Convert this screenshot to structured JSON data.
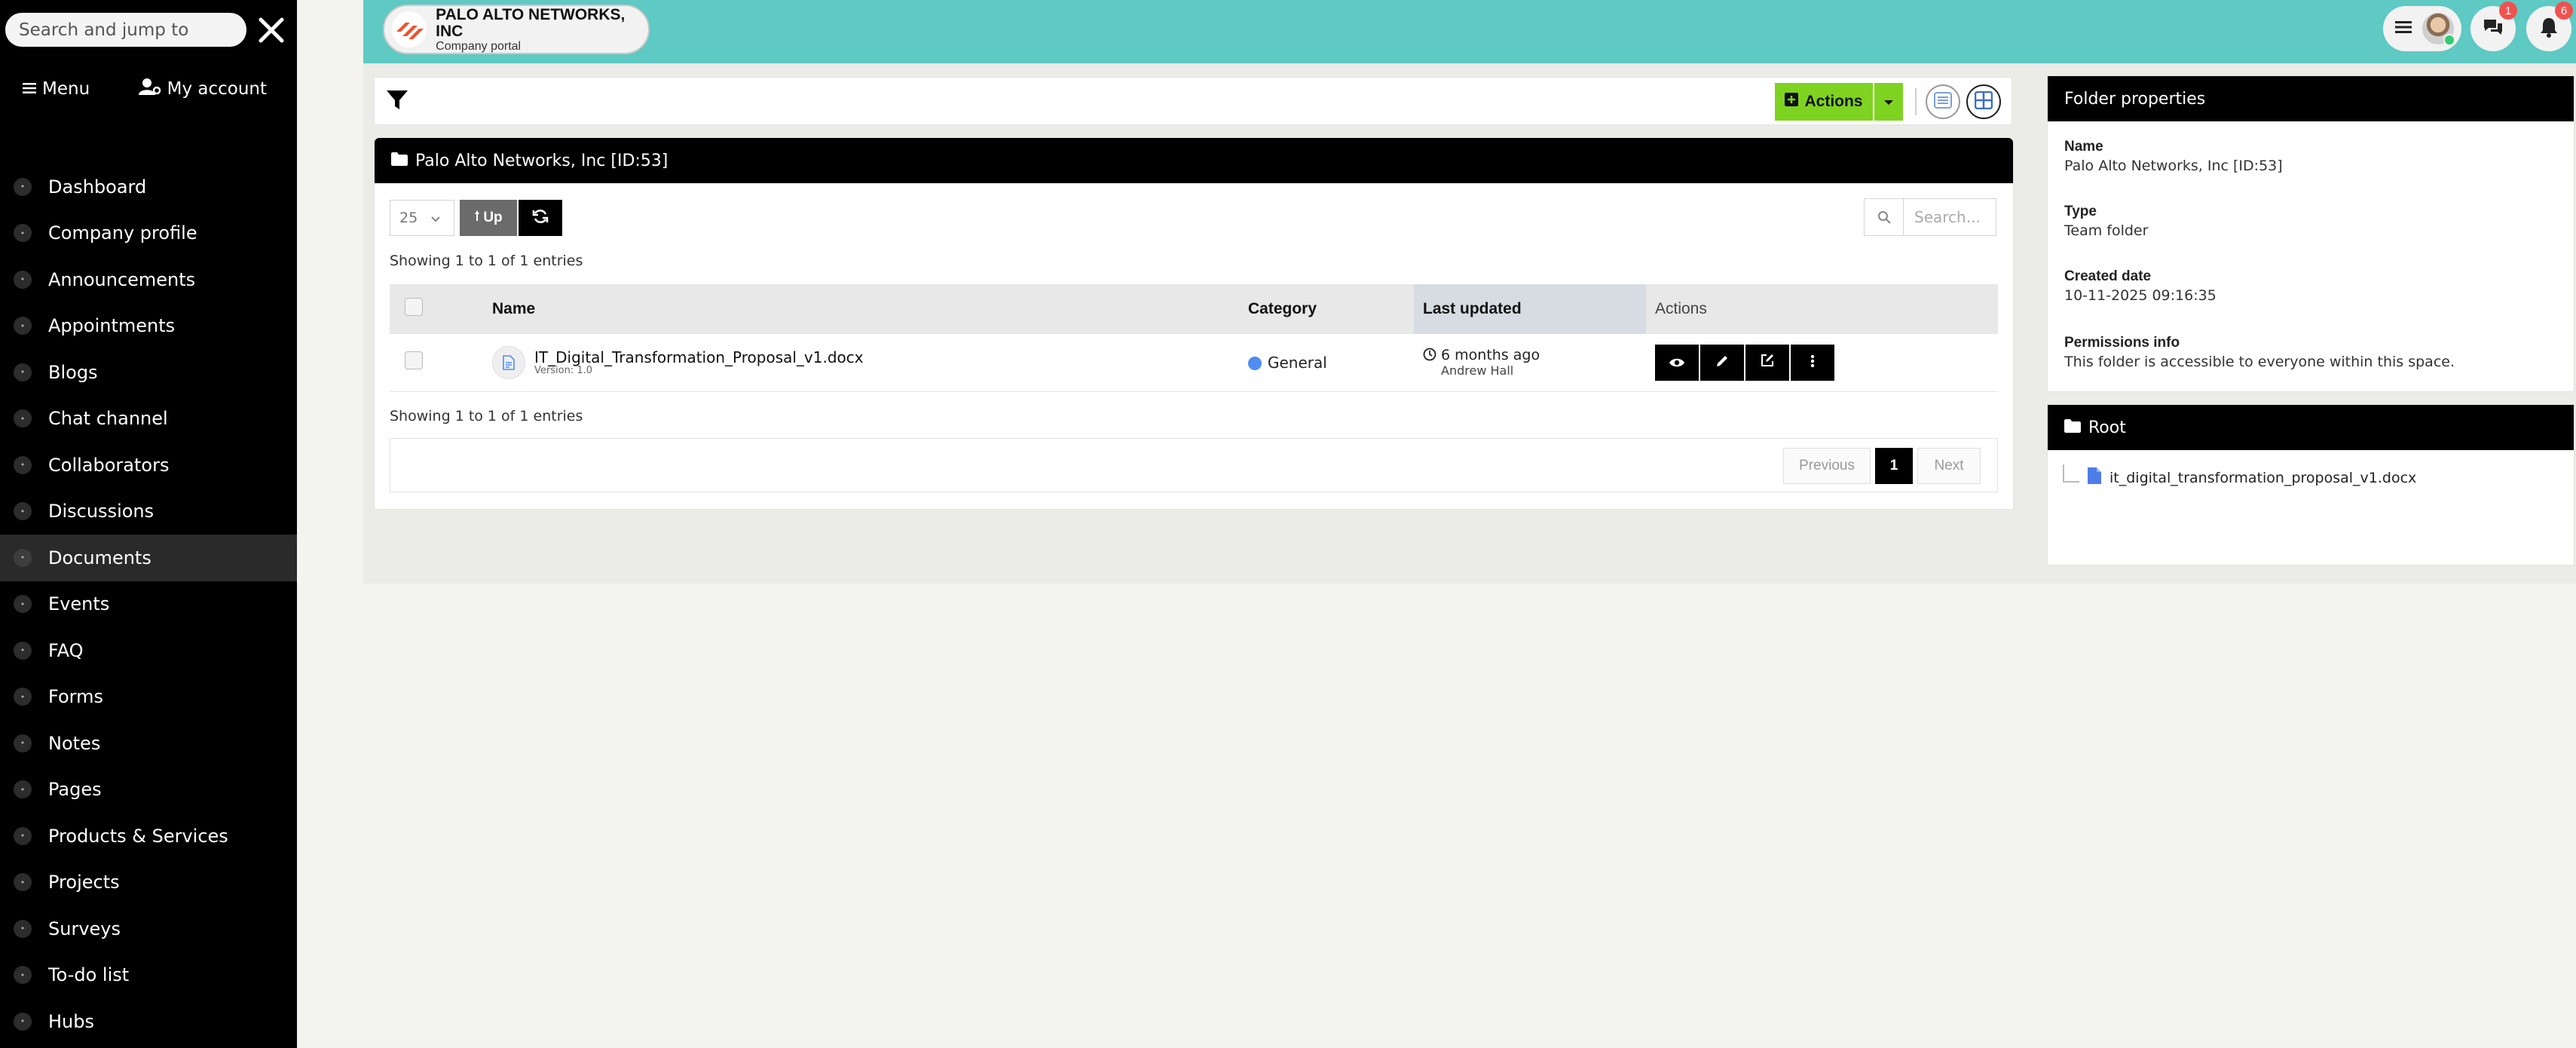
{
  "sidebar": {
    "search_placeholder": "Search and jump to",
    "menu_label": "Menu",
    "account_label": "My account",
    "items": [
      {
        "label": "Dashboard",
        "icon": "home-icon"
      },
      {
        "label": "Company profile",
        "icon": "building-icon"
      },
      {
        "label": "Announcements",
        "icon": "megaphone-icon"
      },
      {
        "label": "Appointments",
        "icon": "calendar-icon"
      },
      {
        "label": "Blogs",
        "icon": "pen-icon"
      },
      {
        "label": "Chat channel",
        "icon": "chat-icon"
      },
      {
        "label": "Collaborators",
        "icon": "users-icon"
      },
      {
        "label": "Discussions",
        "icon": "comment-icon"
      },
      {
        "label": "Documents",
        "icon": "folder-icon",
        "active": true
      },
      {
        "label": "Events",
        "icon": "event-icon"
      },
      {
        "label": "FAQ",
        "icon": "question-icon"
      },
      {
        "label": "Forms",
        "icon": "form-icon"
      },
      {
        "label": "Notes",
        "icon": "note-icon"
      },
      {
        "label": "Pages",
        "icon": "page-icon"
      },
      {
        "label": "Products & Services",
        "icon": "box-icon"
      },
      {
        "label": "Projects",
        "icon": "project-icon"
      },
      {
        "label": "Surveys",
        "icon": "survey-icon"
      },
      {
        "label": "To-do list",
        "icon": "list-icon"
      },
      {
        "label": "Hubs",
        "icon": "hub-icon"
      }
    ]
  },
  "header": {
    "company_name": "PALO ALTO NETWORKS, INC",
    "company_sub": "Company portal",
    "chat_badge": "1",
    "notif_badge": "6"
  },
  "toolbar": {
    "actions_label": "Actions"
  },
  "folder": {
    "title": "Palo Alto Networks, Inc [ID:53]",
    "page_size": "25",
    "up_label": "Up",
    "search_placeholder": "Search...",
    "info_top": "Showing 1 to 1 of 1 entries",
    "info_bottom": "Showing 1 to 1 of 1 entries",
    "columns": [
      "Name",
      "Category",
      "Last updated",
      "Actions"
    ],
    "rows": [
      {
        "name": "IT_Digital_Transformation_Proposal_v1.docx",
        "version": "Version: 1.0",
        "category": "General",
        "category_color": "#4f8df0",
        "updated": "6 months ago",
        "updated_by": "Andrew Hall"
      }
    ],
    "pagination": {
      "previous": "Previous",
      "current": "1",
      "next": "Next"
    }
  },
  "properties": {
    "title": "Folder properties",
    "name_label": "Name",
    "name_value": "Palo Alto Networks, Inc [ID:53]",
    "type_label": "Type",
    "type_value": "Team folder",
    "created_label": "Created date",
    "created_value": "10-11-2025 09:16:35",
    "perm_label": "Permissions info",
    "perm_value": "This folder is accessible to everyone within this space."
  },
  "tree": {
    "title": "Root",
    "file": "it_digital_transformation_proposal_v1.docx"
  },
  "colors": {
    "header": "#5fc9c3",
    "actions": "#7ed321",
    "sidebar": "#000000",
    "badge": "#ef5350"
  }
}
